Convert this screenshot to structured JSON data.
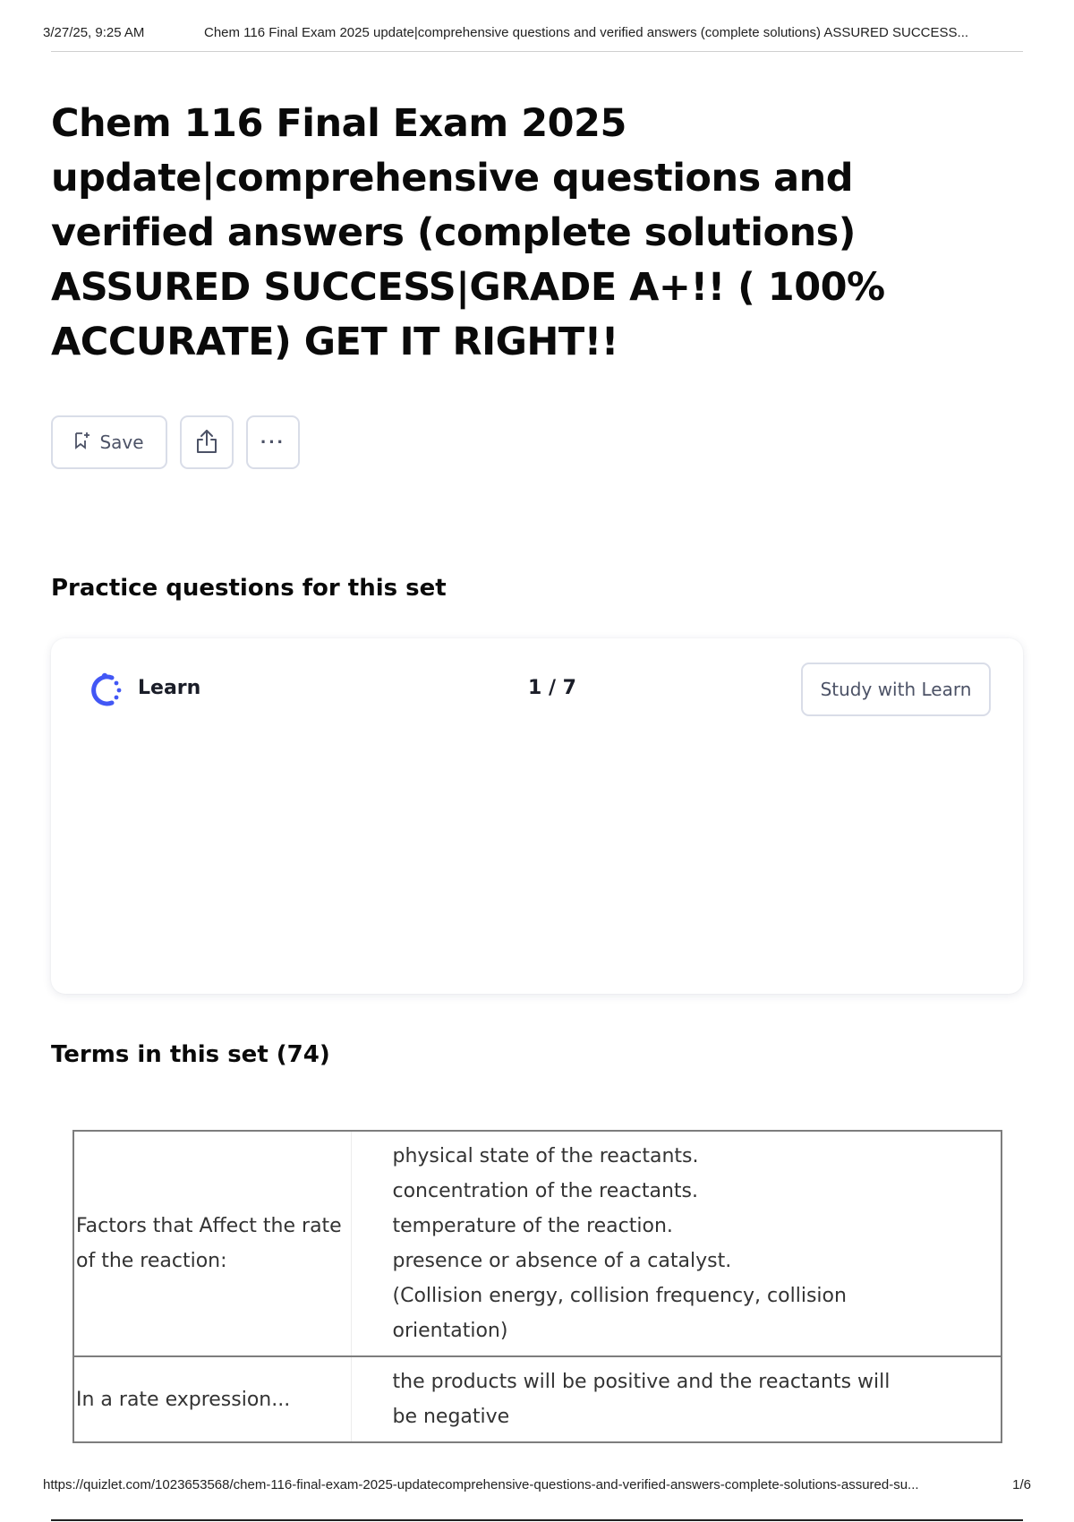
{
  "print_header": {
    "date": "3/27/25, 9:25 AM",
    "title": "Chem 116 Final Exam 2025 update|comprehensive questions and verified answers (complete solutions) ASSURED SUCCESS..."
  },
  "page": {
    "title": "Chem 116 Final Exam 2025 update|comprehensive questions and verified answers (complete solutions) ASSURED SUCCESS|GRADE A+!! ( 100% ACCURATE) GET IT RIGHT!!"
  },
  "toolbar": {
    "save_label": "Save",
    "save_icon": "bookmark-add-icon",
    "share_icon": "share-icon",
    "more_icon": "more-horizontal-icon",
    "more_label": "···"
  },
  "practice": {
    "heading": "Practice questions for this set",
    "mode_icon": "learn-icon",
    "mode_label": "Learn",
    "progress": "1 / 7",
    "progress_current": 1,
    "progress_total": 7,
    "study_button_label": "Study with Learn"
  },
  "terms": {
    "heading": "Terms in this set (74)",
    "rows": [
      {
        "term": "Factors that Affect the rate of the reaction:",
        "definition_lines": [
          "physical state of the reactants.",
          "concentration of the reactants.",
          "temperature of the reaction.",
          "presence or absence of a catalyst.",
          "(Collision energy, collision frequency, collision",
          "orientation)"
        ]
      },
      {
        "term": "In a rate expression...",
        "definition_lines": [
          "the products will be positive and the reactants will",
          "be negative"
        ]
      }
    ]
  },
  "print_footer": {
    "url": "https://quizlet.com/1023653568/chem-116-final-exam-2025-updatecomprehensive-questions-and-verified-answers-complete-solutions-assured-su...",
    "page": "1/6"
  },
  "colors": {
    "learn_icon": "#4257f5",
    "button_border": "#d9dde8",
    "button_text": "#4c5266",
    "table_border": "#7d7d7d"
  }
}
